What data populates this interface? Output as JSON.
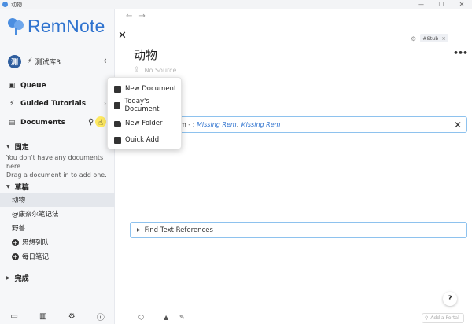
{
  "window": {
    "title": "动物",
    "controls": [
      "—",
      "☐",
      "✕"
    ]
  },
  "sidebar": {
    "logo_text": "RemNote",
    "knowledge_base": {
      "avatar_letter": "测",
      "name": "测试库3"
    },
    "nav": [
      {
        "label": "Queue",
        "icon": "queue-icon"
      },
      {
        "label": "Guided Tutorials",
        "icon": "bolt-icon"
      },
      {
        "label": "Documents",
        "icon": "document-icon"
      }
    ],
    "pinned": {
      "label": "固定",
      "empty_line1": "You don't have any documents here.",
      "empty_line2": "Drag a document in to add one."
    },
    "drafts": {
      "label": "草稿",
      "items": [
        {
          "label": "动物",
          "active": true
        },
        {
          "label": "@康奈尔笔记法"
        },
        {
          "label": "野兽"
        },
        {
          "label": "思想列队",
          "icon": "plus-circle-icon"
        },
        {
          "label": "每日笔记",
          "icon": "plus-circle-icon"
        }
      ]
    },
    "done": {
      "label": "完成"
    }
  },
  "dropdown": {
    "items": [
      "New Document",
      "Today's Document",
      "New Folder",
      "Quick Add"
    ]
  },
  "document": {
    "title": "动物",
    "tag": "#Stub",
    "no_source": "No Source",
    "reference_prefix": "m - : ",
    "reference_missing_1": "Missing Rem",
    "reference_sep": ", ",
    "reference_missing_2": "Missing Rem",
    "find_text_refs": "Find Text References"
  },
  "footer": {
    "help_label": "?",
    "portal_placeholder": "Add a Portal"
  },
  "colors": {
    "accent": "#2f73cf",
    "sidebar_bg": "#f6f7f9",
    "box_border": "#8ec2ee",
    "cursor_highlight": "#ffe646"
  }
}
